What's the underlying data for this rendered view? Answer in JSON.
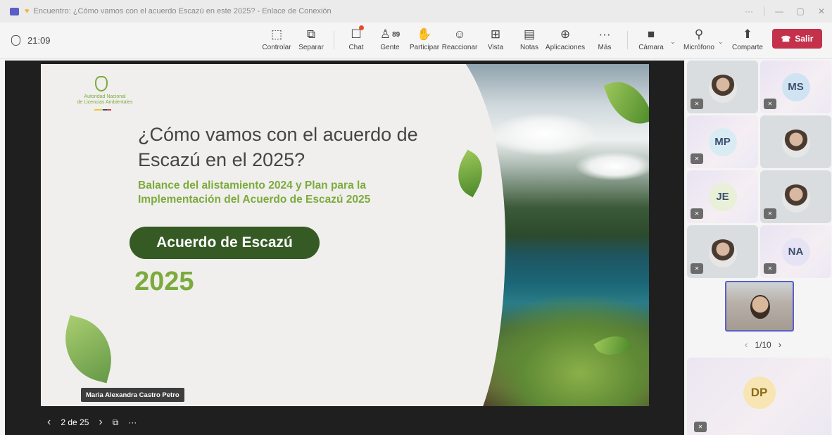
{
  "window": {
    "title": "Encuentro: ¿Cómo vamos con el acuerdo Escazú en este 2025? - Enlace de Conexión",
    "controls": [
      "···",
      "—",
      "▢",
      "✕"
    ]
  },
  "toolbar": {
    "timer": "21:09",
    "buttons": {
      "controlar": "Controlar",
      "separar": "Separar",
      "chat": "Chat",
      "gente": "Gente",
      "gente_count": "89",
      "participar": "Participar",
      "reaccionar": "Reaccionar",
      "vista": "Vista",
      "notas": "Notas",
      "aplicaciones": "Aplicaciones",
      "mas": "Más",
      "camara": "Cámara",
      "microfono": "Micrófono",
      "comparte": "Comparte",
      "salir": "Salir"
    },
    "icons": {
      "controlar": "monitor-pointer-icon",
      "separar": "pop-out-icon",
      "chat": "chat-icon",
      "gente": "people-icon",
      "participar": "raise-hand-icon",
      "reaccionar": "smile-icon",
      "vista": "grid-view-icon",
      "notas": "notes-icon",
      "aplicaciones": "add-app-icon",
      "mas": "more-icon",
      "camara": "camera-off-icon",
      "microfono": "mic-off-icon",
      "comparte": "share-icon",
      "salir": "phone-hangup-icon"
    }
  },
  "slide": {
    "logo_line1": "Autoridad Nacional",
    "logo_line2": "de Licencias Ambientales",
    "title": "¿Cómo vamos con el acuerdo de Escazú en el 2025?",
    "subtitle": "Balance del alistamiento 2024 y Plan para la Implementación del Acuerdo de Escazú 2025",
    "pill": "Acuerdo de Escazú",
    "year": "2025",
    "presenter": "Maria Alexandra Castro Petro"
  },
  "slide_nav": {
    "prev": "‹",
    "position": "2 de 25",
    "next": "›",
    "more": "···"
  },
  "participants": [
    {
      "initials": "",
      "type": "video"
    },
    {
      "initials": "MS",
      "type": "avatar",
      "color": "#cfe3f3"
    },
    {
      "initials": "MP",
      "type": "avatar",
      "color": "#d9ecf4"
    },
    {
      "initials": "",
      "type": "video"
    },
    {
      "initials": "JE",
      "type": "avatar",
      "color": "#e8f0d8"
    },
    {
      "initials": "",
      "type": "video"
    },
    {
      "initials": "",
      "type": "video"
    },
    {
      "initials": "NA",
      "type": "avatar",
      "color": "#e6e4f4"
    }
  ],
  "pager": {
    "label": "1/10"
  },
  "big_tile": {
    "initials": "DP",
    "color": "#f7e5b3"
  },
  "colors": {
    "accent": "#5b5fc7",
    "leave": "#c4314b",
    "slide_green": "#7cab3c",
    "pill_green": "#355a24"
  }
}
